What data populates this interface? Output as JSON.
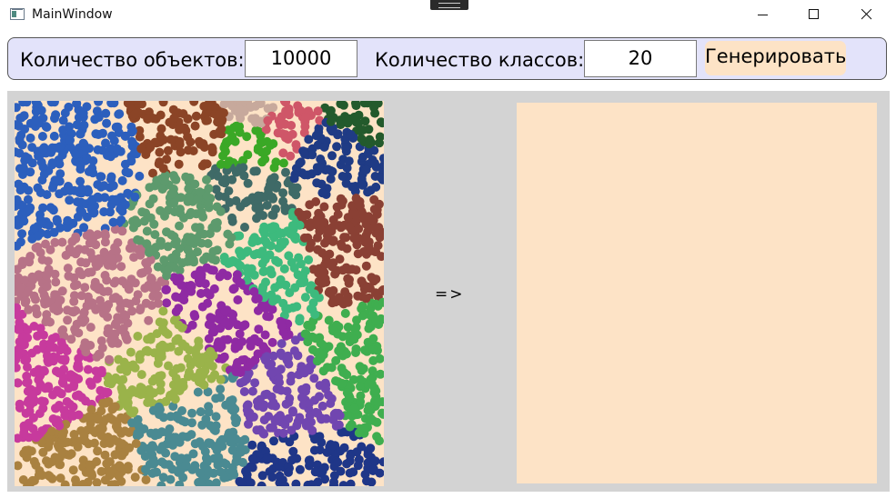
{
  "window": {
    "title": "MainWindow"
  },
  "toolbar": {
    "objects_label": "Количество объектов:",
    "objects_value": "10000",
    "classes_label": "Количество классов:",
    "classes_value": "20",
    "generate_label": "Генерировать"
  },
  "main": {
    "arrow": "=>"
  },
  "colors": {
    "toolbar_bg": "#e3e3fa",
    "button_bg": "#fde3c6",
    "canvas_bg": "#fde3c6",
    "workarea_bg": "#d3d3d3"
  },
  "clusters": [
    {
      "color": "#2c5fbd"
    },
    {
      "color": "#8b4426"
    },
    {
      "color": "#c7a99c"
    },
    {
      "color": "#cf5668"
    },
    {
      "color": "#235a2c"
    },
    {
      "color": "#1f3b85"
    },
    {
      "color": "#3f6a67"
    },
    {
      "color": "#3aa826"
    },
    {
      "color": "#5d9a6d"
    },
    {
      "color": "#3dba7d"
    },
    {
      "color": "#8a4034"
    },
    {
      "color": "#b77287"
    },
    {
      "color": "#8f2aa3"
    },
    {
      "color": "#c73a9d"
    },
    {
      "color": "#9ab34a"
    },
    {
      "color": "#4a8a92"
    },
    {
      "color": "#7146b0"
    },
    {
      "color": "#3fae4f"
    },
    {
      "color": "#a98140"
    },
    {
      "color": "#1f3688"
    }
  ]
}
